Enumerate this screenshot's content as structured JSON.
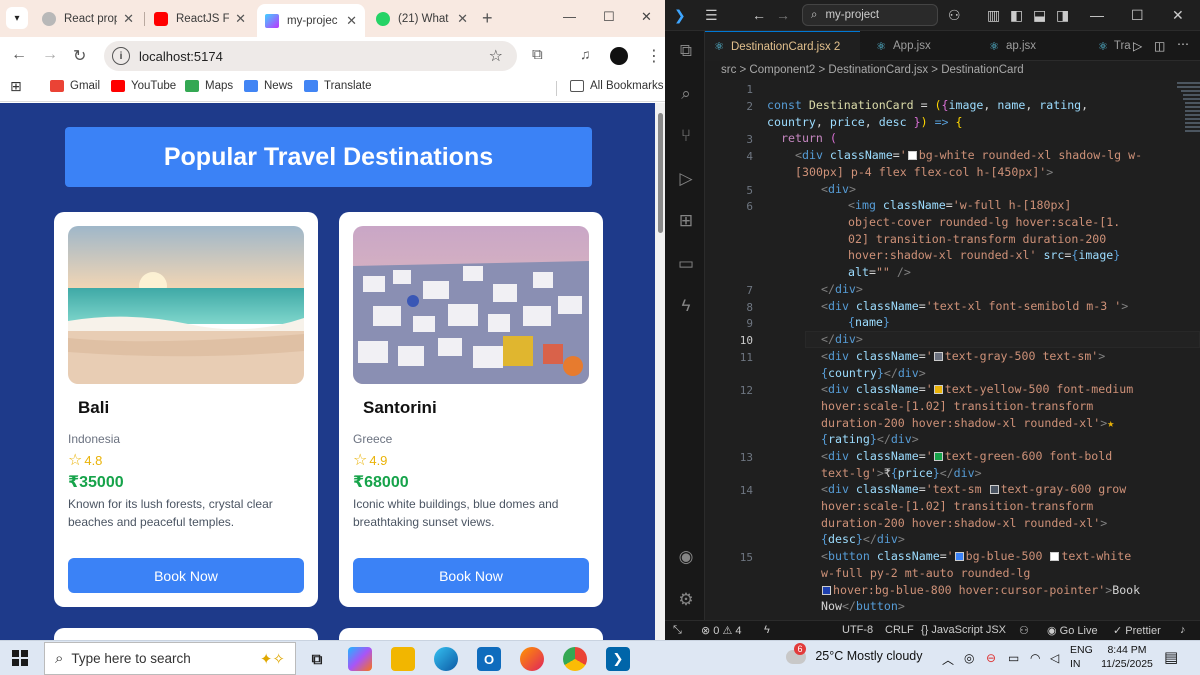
{
  "browser": {
    "tabs": [
      {
        "label": "React prop",
        "icon": "react-icon",
        "color": "#61dafb"
      },
      {
        "label": "ReactJS Fu",
        "icon": "youtube-icon",
        "color": "#ff0000"
      },
      {
        "label": "my-projec",
        "icon": "vite-icon",
        "color": "#a855f7"
      },
      {
        "label": "(21) What",
        "icon": "whatsapp-icon",
        "color": "#25d366"
      }
    ],
    "url": "localhost:5174",
    "bookmarks": [
      {
        "label": "Gmail",
        "color": "#ea4335"
      },
      {
        "label": "YouTube",
        "color": "#ff0000"
      },
      {
        "label": "Maps",
        "color": "#34a853"
      },
      {
        "label": "News",
        "color": "#4285f4"
      },
      {
        "label": "Translate",
        "color": "#4285f4"
      }
    ],
    "all_bookmarks": "All Bookmarks"
  },
  "page": {
    "title": "Popular Travel Destinations",
    "bg_color": "#1e3a8a",
    "cards": [
      {
        "name": "Bali",
        "country": "Indonesia",
        "rating": "4.8",
        "price": "₹35000",
        "desc": "Known for its lush forests, crystal clear beaches and peaceful temples.",
        "button": "Book Now"
      },
      {
        "name": "Santorini",
        "country": "Greece",
        "rating": "4.9",
        "price": "₹68000",
        "desc": "Iconic white buildings, blue domes and breathtaking sunset views.",
        "button": "Book Now"
      }
    ]
  },
  "vscode": {
    "search": "my-project",
    "tabs": [
      {
        "label": "DestinationCard.jsx 2"
      },
      {
        "label": "App.jsx"
      },
      {
        "label": "ap.jsx"
      },
      {
        "label": "Tra"
      }
    ],
    "breadcrumb": "src > Component2 > DestinationCard.jsx > DestinationCard",
    "line_numbers": [
      "1",
      "2",
      "3",
      "4",
      "5",
      "6",
      "7",
      "8",
      "9",
      "10",
      "11",
      "12",
      "13",
      "14",
      "15"
    ],
    "status": {
      "errors": "0",
      "warnings": "4",
      "encoding": "UTF-8",
      "eol": "CRLF",
      "language": "JavaScript JSX",
      "golive": "Go Live",
      "prettier": "Prettier"
    }
  },
  "taskbar": {
    "search_placeholder": "Type here to search",
    "weather_badge": "6",
    "weather": "25°C  Mostly cloudy",
    "lang": "ENG",
    "region": "IN",
    "time": "8:44 PM",
    "date": "11/25/2025"
  }
}
